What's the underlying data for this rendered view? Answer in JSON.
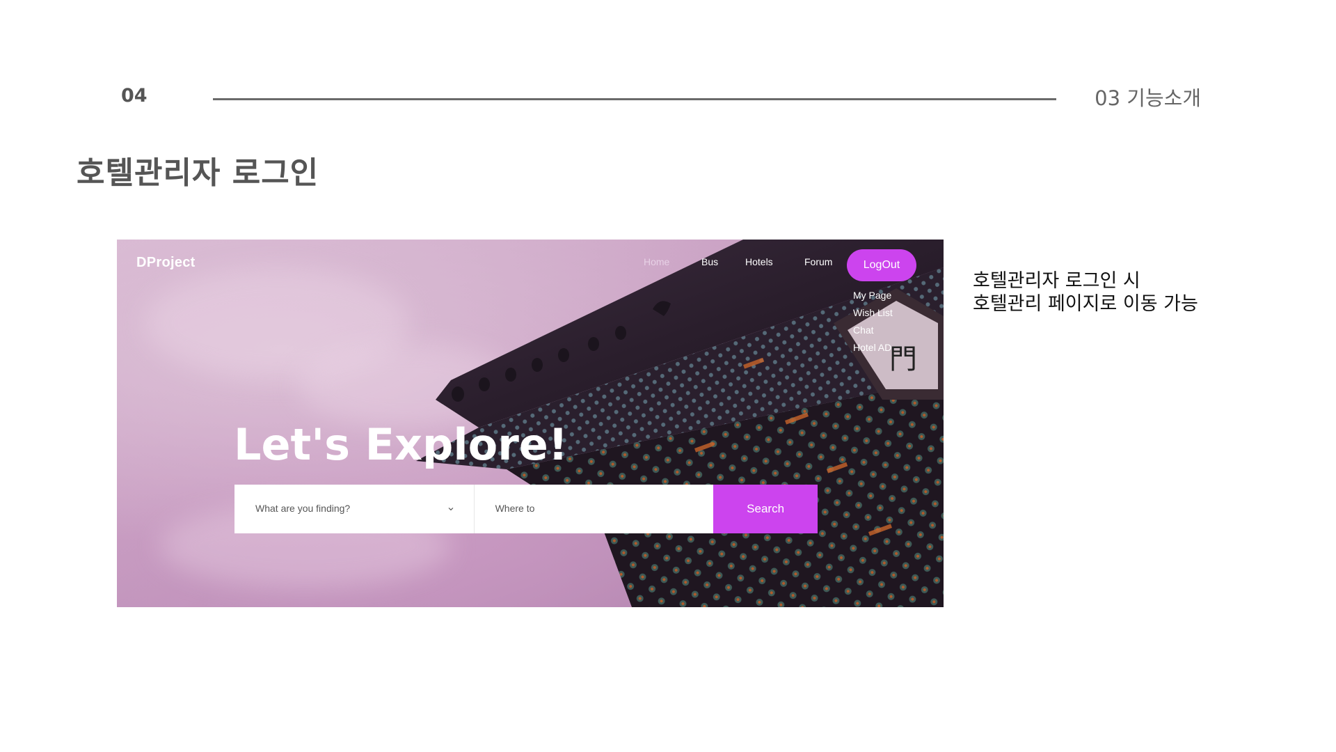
{
  "slide": {
    "page_number": "04",
    "section": "03 기능소개",
    "title": "호텔관리자 로그인",
    "description_lines": [
      "호텔관리자 로그인 시",
      "호텔관리 페이지로 이동 가능"
    ]
  },
  "site": {
    "brand": "DProject",
    "nav": [
      "Home",
      "Bus",
      "Hotels",
      "Forum"
    ],
    "logout_label": "LogOut",
    "dropdown": [
      "My Page",
      "Wish List",
      "Chat",
      "Hotel AD"
    ],
    "hero_title": "Let's Explore!",
    "search": {
      "category_placeholder": "What are you finding?",
      "destination_placeholder": "Where to",
      "button_label": "Search"
    }
  },
  "colors": {
    "accent": "#cc44ee",
    "heading": "#555555",
    "rule": "#6a6a6a"
  }
}
